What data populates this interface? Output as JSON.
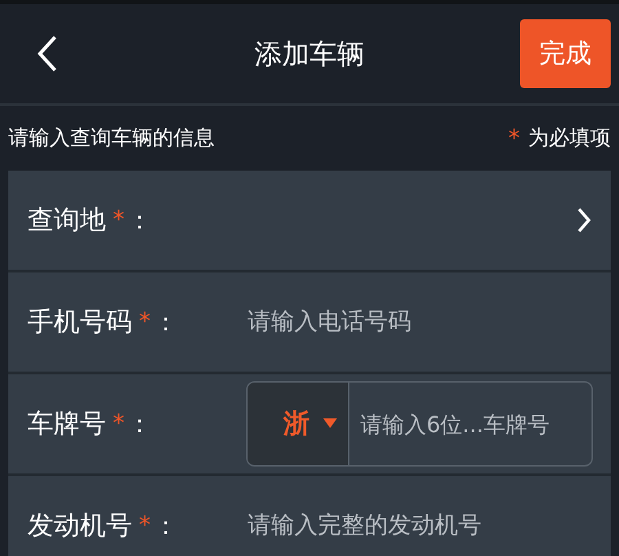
{
  "header": {
    "title": "添加车辆",
    "done_button": "完成"
  },
  "section": {
    "hint": "请输入查询车辆的信息",
    "required_mark": "*",
    "required_note": "为必填项"
  },
  "rows": [
    {
      "kind": "select",
      "label": "查询地",
      "required": true,
      "mark": "*",
      "colon": "："
    },
    {
      "kind": "input",
      "label": "手机号码",
      "required": true,
      "mark": "*",
      "colon": "：",
      "placeholder": "请输入电话号码"
    },
    {
      "kind": "plate",
      "label": "车牌号",
      "required": true,
      "mark": "*",
      "colon": "：",
      "province": "浙",
      "placeholder": "请输入6位...车牌号"
    },
    {
      "kind": "input",
      "label": "发动机号",
      "required": true,
      "mark": "*",
      "colon": "：",
      "placeholder": "请输入完整的发动机号"
    }
  ]
}
